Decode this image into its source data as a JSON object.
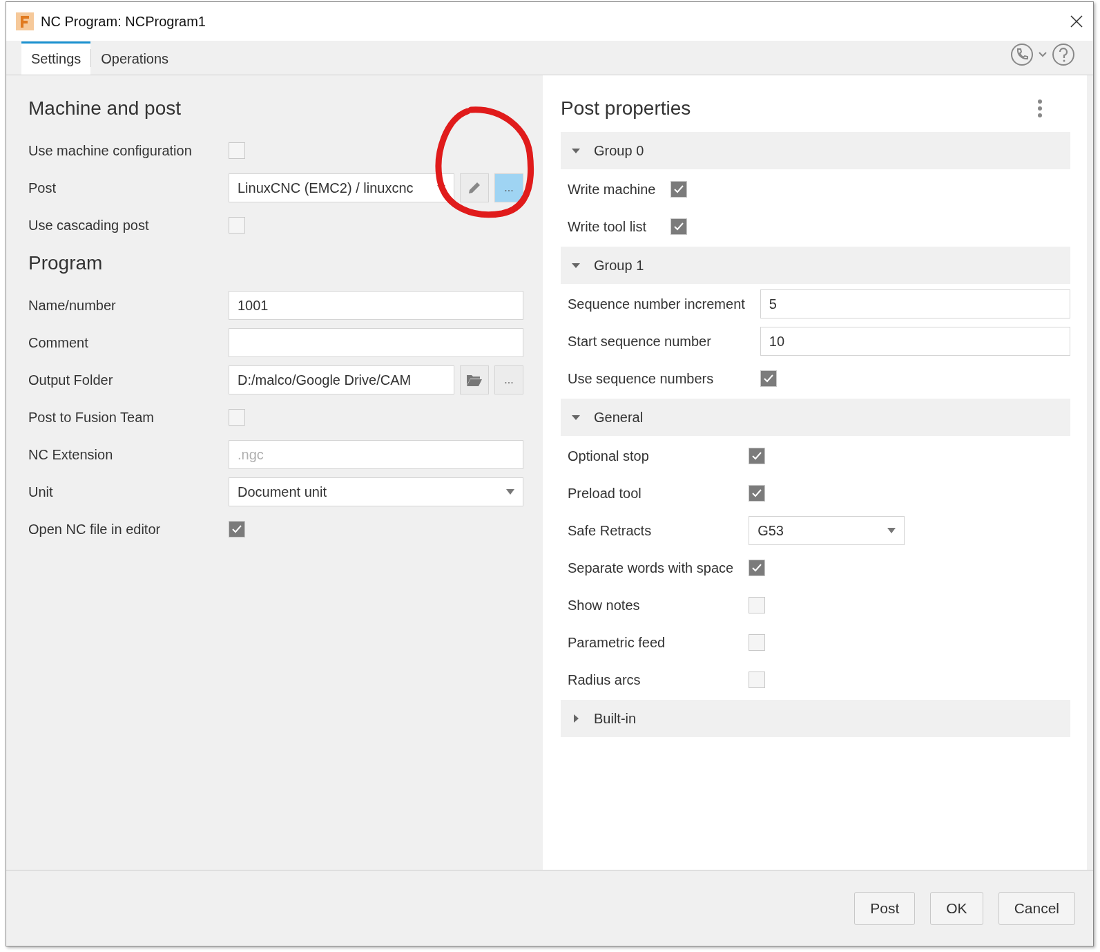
{
  "window": {
    "title": "NC Program: NCProgram1"
  },
  "tabs": [
    {
      "label": "Settings",
      "selected": true
    },
    {
      "label": "Operations",
      "selected": false
    }
  ],
  "left_sections": [
    {
      "title": "Machine and post",
      "rows": [
        {
          "kind": "checkbox",
          "label": "Use machine configuration",
          "checked": false
        },
        {
          "kind": "post",
          "label": "Post",
          "value": "LinuxCNC (EMC2) / linuxcnc",
          "browse": "...",
          "annotated": true
        },
        {
          "kind": "checkbox",
          "label": "Use cascading post",
          "checked": false
        }
      ]
    },
    {
      "title": "Program",
      "rows": [
        {
          "kind": "text",
          "label": "Name/number",
          "value": "1001"
        },
        {
          "kind": "text",
          "label": "Comment"
        },
        {
          "kind": "folder",
          "label": "Output Folder",
          "value": "D:/malco/Google Drive/CAM",
          "browse": "..."
        },
        {
          "kind": "checkbox",
          "label": "Post to Fusion Team",
          "checked": false
        },
        {
          "kind": "text",
          "label": "NC Extension",
          "placeholder": ".ngc"
        },
        {
          "kind": "dropdown",
          "label": "Unit",
          "value": "Document unit"
        },
        {
          "kind": "checkbox",
          "label": "Open NC file in editor",
          "checked": true
        }
      ]
    }
  ],
  "post_properties": {
    "title": "Post properties",
    "groups": [
      {
        "name": "Group 0",
        "expanded": true,
        "rows": [
          {
            "kind": "checkbox",
            "label": "Write machine",
            "checked": true
          },
          {
            "kind": "checkbox",
            "label": "Write tool list",
            "checked": true
          }
        ]
      },
      {
        "name": "Group 1",
        "expanded": true,
        "rows": [
          {
            "kind": "text",
            "label": "Sequence number increment",
            "value": "5"
          },
          {
            "kind": "text",
            "label": "Start sequence number",
            "value": "10"
          },
          {
            "kind": "checkbox",
            "label": "Use sequence numbers",
            "checked": true
          }
        ]
      },
      {
        "name": "General",
        "expanded": true,
        "rows": [
          {
            "kind": "checkbox",
            "label": "Optional stop",
            "checked": true
          },
          {
            "kind": "checkbox",
            "label": "Preload tool",
            "checked": true
          },
          {
            "kind": "dropdown",
            "label": "Safe Retracts",
            "value": "G53"
          },
          {
            "kind": "checkbox",
            "label": "Separate words with space",
            "checked": true
          },
          {
            "kind": "checkbox",
            "label": "Show notes",
            "checked": false
          },
          {
            "kind": "checkbox",
            "label": "Parametric feed",
            "checked": false
          },
          {
            "kind": "checkbox",
            "label": "Radius arcs",
            "checked": false
          }
        ]
      },
      {
        "name": "Built-in",
        "expanded": false
      }
    ]
  },
  "buttons": [
    "Post",
    "OK",
    "Cancel"
  ]
}
